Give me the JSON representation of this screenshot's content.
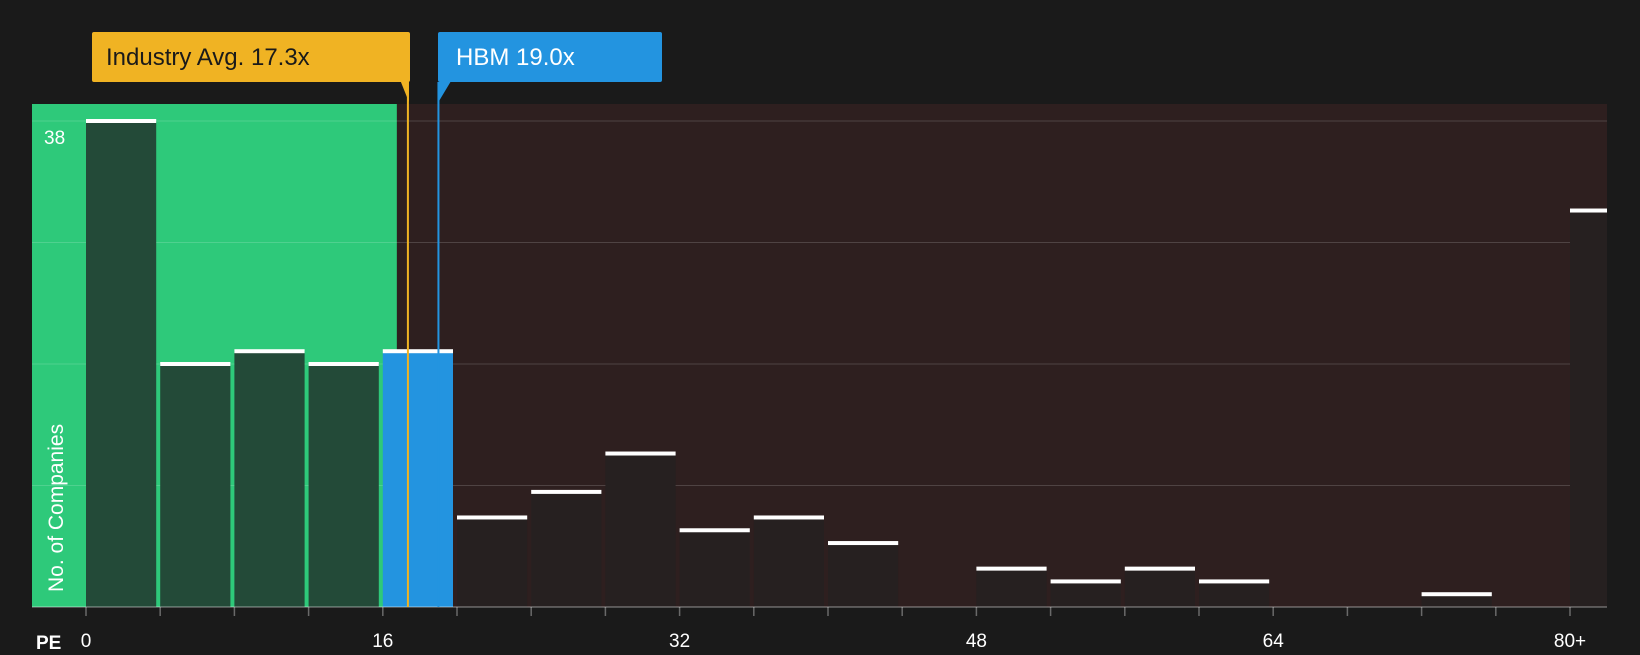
{
  "chart_data": {
    "type": "bar",
    "title": "",
    "xlabel": "PE",
    "ylabel": "No. of Companies",
    "x_tick_labels": [
      "0",
      "16",
      "32",
      "48",
      "64",
      "80+"
    ],
    "x_tick_values": [
      0,
      16,
      32,
      48,
      64,
      80
    ],
    "y_top_label": "38",
    "ylim": [
      0,
      38
    ],
    "grid": true,
    "bin_width": 4,
    "bins": [
      {
        "start": 0,
        "value": 38
      },
      {
        "start": 4,
        "value": 19
      },
      {
        "start": 8,
        "value": 20
      },
      {
        "start": 12,
        "value": 19
      },
      {
        "start": 16,
        "value": 20
      },
      {
        "start": 20,
        "value": 7
      },
      {
        "start": 24,
        "value": 9
      },
      {
        "start": 28,
        "value": 12
      },
      {
        "start": 32,
        "value": 6
      },
      {
        "start": 36,
        "value": 7
      },
      {
        "start": 40,
        "value": 5
      },
      {
        "start": 44,
        "value": 0
      },
      {
        "start": 48,
        "value": 3
      },
      {
        "start": 52,
        "value": 2
      },
      {
        "start": 56,
        "value": 3
      },
      {
        "start": 60,
        "value": 2
      },
      {
        "start": 64,
        "value": 0
      },
      {
        "start": 68,
        "value": 0
      },
      {
        "start": 72,
        "value": 1
      },
      {
        "start": 76,
        "value": 0
      },
      {
        "start": 80,
        "value": 31
      }
    ],
    "industry_avg": {
      "label": "Industry Avg. 17.3x",
      "value": 17.3
    },
    "company": {
      "label": "HBM 19.0x",
      "value": 19.0
    },
    "colors": {
      "background": "#1a1a1a",
      "below_avg_region": "#2ec97a",
      "above_avg_region": "#2e1f1f",
      "bar_in_green": "#234a38",
      "bar_default": "#262020",
      "company_bar": "#2394e0",
      "industry_marker": "#f0b323",
      "company_marker": "#2394e0",
      "bar_cap": "#ffffff",
      "axis_text": "#ffffff"
    }
  }
}
